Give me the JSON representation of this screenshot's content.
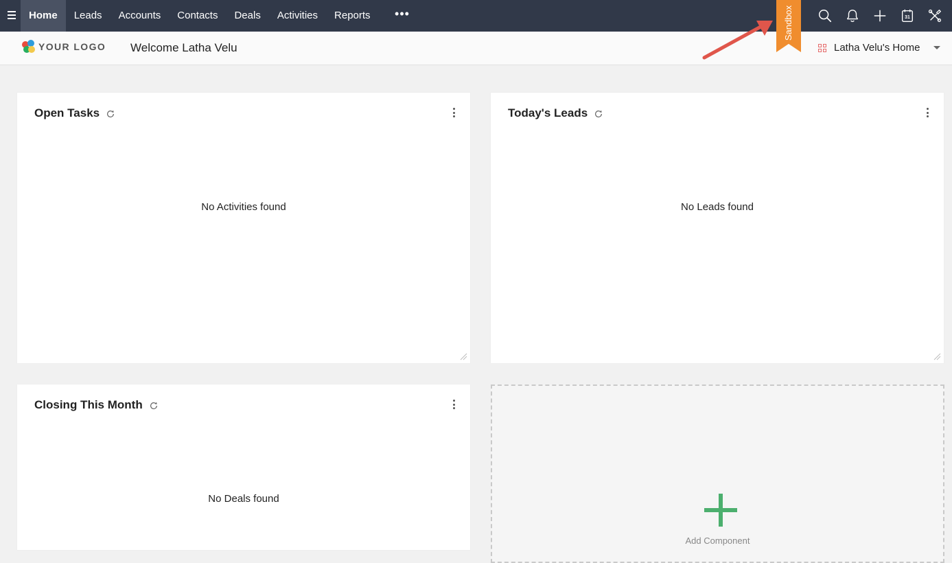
{
  "nav": {
    "items": [
      {
        "label": "Home",
        "active": true
      },
      {
        "label": "Leads"
      },
      {
        "label": "Accounts"
      },
      {
        "label": "Contacts"
      },
      {
        "label": "Deals"
      },
      {
        "label": "Activities"
      },
      {
        "label": "Reports"
      }
    ],
    "more_label": "•••",
    "icons": [
      "search-icon",
      "bell-icon",
      "plus-icon",
      "calendar-icon",
      "tools-icon"
    ],
    "calendar_day": "31"
  },
  "ribbon": {
    "label": "Sandbox",
    "color": "#f08d2e"
  },
  "header": {
    "logo_text": "YOUR LOGO",
    "welcome": "Welcome Latha Velu",
    "home_selector": "Latha Velu's Home"
  },
  "cards": {
    "open_tasks": {
      "title": "Open Tasks",
      "empty": "No Activities found"
    },
    "todays_leads": {
      "title": "Today's Leads",
      "empty": "No Leads found"
    },
    "closing_month": {
      "title": "Closing This Month",
      "empty": "No Deals found"
    }
  },
  "add_component": {
    "label": "Add Component",
    "color": "#4caf6e"
  },
  "colors": {
    "topbar": "#313949",
    "annotation_arrow": "#e0564b"
  }
}
